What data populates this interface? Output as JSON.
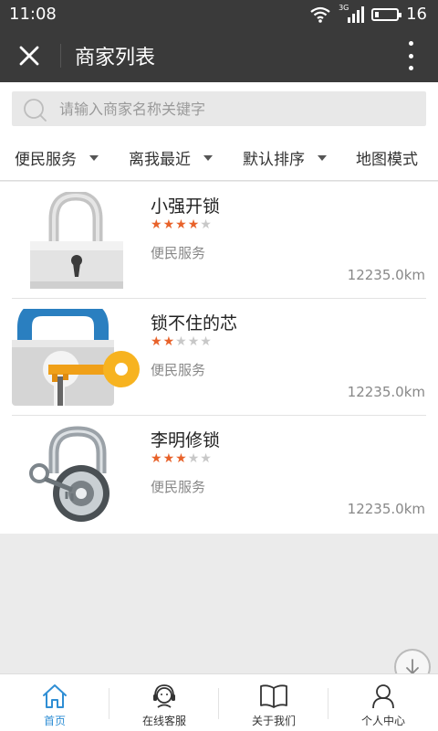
{
  "status": {
    "time": "11:08",
    "network": "3G",
    "battery": "16",
    "battery_level": 0.16
  },
  "header": {
    "title": "商家列表",
    "close_icon": "close-icon",
    "more_icon": "more-vert-icon"
  },
  "search": {
    "placeholder": "请输入商家名称关键字",
    "value": ""
  },
  "filters": [
    {
      "label": "便民服务",
      "has_dropdown": true
    },
    {
      "label": "离我最近",
      "has_dropdown": true
    },
    {
      "label": "默认排序",
      "has_dropdown": true
    },
    {
      "label": "地图模式",
      "has_dropdown": false
    }
  ],
  "merchants": [
    {
      "name": "小强开锁",
      "rating": 4,
      "max_rating": 5,
      "category": "便民服务",
      "distance": "12235.0km",
      "image": "padlock-white-image"
    },
    {
      "name": "锁不住的芯",
      "rating": 2,
      "max_rating": 5,
      "category": "便民服务",
      "distance": "12235.0km",
      "image": "padlock-key-image"
    },
    {
      "name": "李明修锁",
      "rating": 3,
      "max_rating": 5,
      "category": "便民服务",
      "distance": "12235.0km",
      "image": "padlock-chrome-image"
    }
  ],
  "nav": [
    {
      "label": "首页",
      "icon": "home-icon",
      "active": true
    },
    {
      "label": "在线客服",
      "icon": "customer-service-icon",
      "active": false
    },
    {
      "label": "关于我们",
      "icon": "book-icon",
      "active": false
    },
    {
      "label": "个人中心",
      "icon": "user-icon",
      "active": false
    }
  ],
  "colors": {
    "header_bg": "#3a3a3a",
    "star_active": "#e8622a",
    "nav_active": "#2f8ed4"
  }
}
